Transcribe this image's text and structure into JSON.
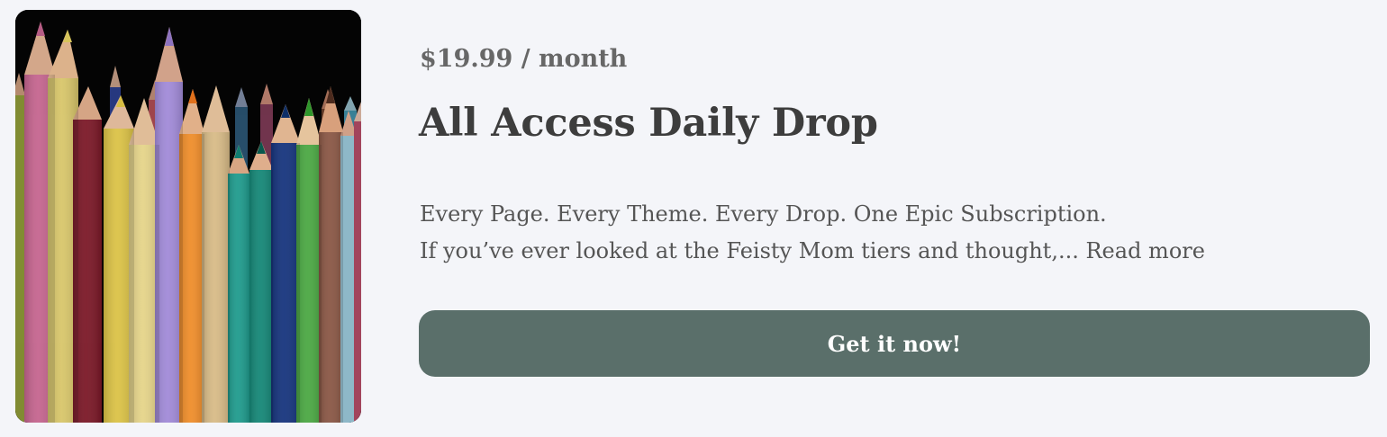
{
  "product": {
    "price": "$19.99 / month",
    "title": "All Access Daily Drop",
    "description_line1": "Every Page. Every Theme. Every Drop. One Epic Subscription.",
    "description_line2": "If you’ve ever looked at the Feisty Mom tiers and thought,...",
    "read_more_label": "Read more",
    "cta_label": "Get it now!"
  },
  "image": {
    "subject": "colored pencils",
    "icon": "product-photo"
  },
  "colors": {
    "background": "#f4f5f9",
    "button": "#5a6f6a",
    "button_text": "#ffffff",
    "title_text": "#3d3d3d",
    "price_text": "#676767",
    "body_text": "#555555"
  }
}
